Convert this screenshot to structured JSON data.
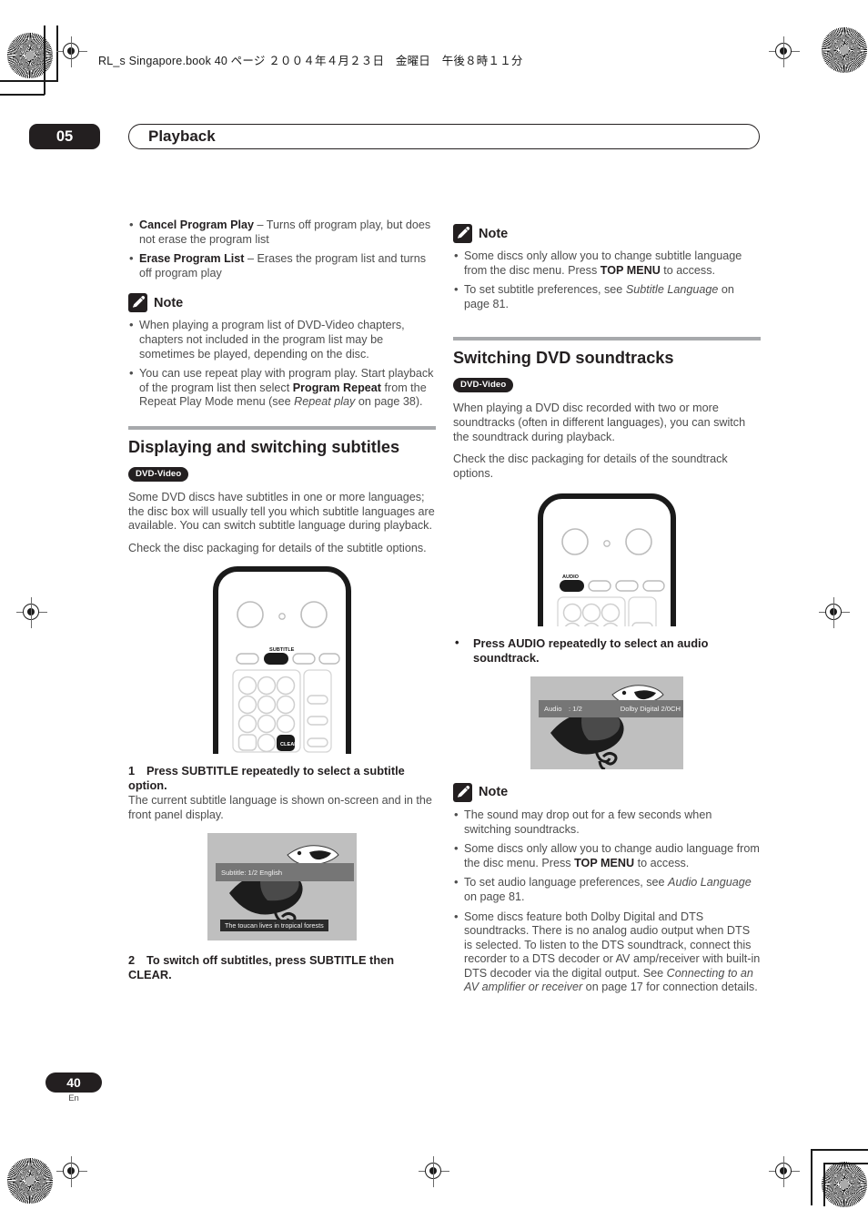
{
  "meta": {
    "running_head": "RL_s Singapore.book 40 ページ ２００４年４月２３日　金曜日　午後８時１１分",
    "chapter_number": "05",
    "chapter_title": "Playback",
    "page_number": "40",
    "page_language": "En",
    "accent_color": "#231f20",
    "rule_color": "#a7a9ac"
  },
  "left_column": {
    "program_bullets": [
      {
        "term": "Cancel Program Play",
        "rest": " – Turns off program play, but does not erase the program list"
      },
      {
        "term": "Erase Program List",
        "rest": " – Erases the program list and turns off program play"
      }
    ],
    "note1": {
      "label": "Note",
      "icon": "pencil-note-icon",
      "items": [
        {
          "parts": [
            {
              "text": "When playing a program list of DVD-Video chapters, chapters not included in the program list may be sometimes be played, depending on the disc.",
              "style": "normal"
            }
          ]
        },
        {
          "parts": [
            {
              "text": "You can use repeat play with program play. Start playback of the program list then select ",
              "style": "normal"
            },
            {
              "text": "Program Repeat",
              "style": "bold"
            },
            {
              "text": " from the Repeat Play Mode menu (see ",
              "style": "normal"
            },
            {
              "text": "Repeat play",
              "style": "italic"
            },
            {
              "text": " on page 38).",
              "style": "normal"
            }
          ]
        }
      ]
    },
    "section": {
      "title": "Displaying and switching subtitles",
      "badge": "DVD-Video",
      "paragraphs": [
        "Some DVD discs have subtitles in one or more languages; the disc box will usually tell you which subtitle languages are available. You can switch subtitle language during playback.",
        "Check the disc packaging for details of the subtitle options."
      ]
    },
    "remote": {
      "name": "remote-control-subtitle",
      "highlighted_buttons": [
        "SUBTITLE",
        "CLEAR"
      ],
      "subtitle_label": "SUBTITLE",
      "clear_label": "CLEAR"
    },
    "step1": {
      "number": "1",
      "heading": "Press SUBTITLE repeatedly to select a subtitle option.",
      "body": "The current subtitle language is shown on-screen and in the front panel display."
    },
    "osd": {
      "name": "on-screen-display-subtitle",
      "status_text": "Subtitle: 1/2 English",
      "caption_text": "The toucan lives in tropical forests"
    },
    "step2": {
      "number": "2",
      "heading": "To switch off subtitles, press SUBTITLE then CLEAR."
    }
  },
  "right_column": {
    "note1": {
      "label": "Note",
      "icon": "pencil-note-icon",
      "items": [
        {
          "parts": [
            {
              "text": "Some discs only allow you to change subtitle language from the disc menu. Press ",
              "style": "normal"
            },
            {
              "text": "TOP MENU",
              "style": "bold"
            },
            {
              "text": " to access.",
              "style": "normal"
            }
          ]
        },
        {
          "parts": [
            {
              "text": "To set subtitle preferences, see ",
              "style": "normal"
            },
            {
              "text": "Subtitle Language",
              "style": "italic"
            },
            {
              "text": " on page 81.",
              "style": "normal"
            }
          ]
        }
      ]
    },
    "section": {
      "title": "Switching DVD soundtracks",
      "badge": "DVD-Video",
      "paragraphs": [
        "When playing a DVD disc recorded with two or more soundtracks (often in different languages), you can switch the soundtrack during playback.",
        "Check the disc packaging for details of the soundtrack options."
      ]
    },
    "remote": {
      "name": "remote-control-audio",
      "highlighted_buttons": [
        "AUDIO"
      ],
      "audio_label": "AUDIO"
    },
    "step_bullet": {
      "heading": "Press AUDIO repeatedly to select an audio soundtrack."
    },
    "osd": {
      "name": "on-screen-display-audio",
      "status_left": "Audio　: 1/2",
      "status_right": "Dolby Digital 2/0CH"
    },
    "note2": {
      "label": "Note",
      "icon": "pencil-note-icon",
      "items": [
        {
          "parts": [
            {
              "text": "The sound may drop out for a few seconds when switching soundtracks.",
              "style": "normal"
            }
          ]
        },
        {
          "parts": [
            {
              "text": "Some discs only allow you to change audio language from the disc menu. Press ",
              "style": "normal"
            },
            {
              "text": "TOP MENU",
              "style": "bold"
            },
            {
              "text": " to access.",
              "style": "normal"
            }
          ]
        },
        {
          "parts": [
            {
              "text": "To set audio language preferences, see ",
              "style": "normal"
            },
            {
              "text": "Audio Language",
              "style": "italic"
            },
            {
              "text": " on page 81.",
              "style": "normal"
            }
          ]
        },
        {
          "parts": [
            {
              "text": "Some discs feature both Dolby Digital and DTS soundtracks. There is no analog audio output when DTS is selected. To listen to the DTS soundtrack, connect this recorder to a DTS decoder or AV amp/receiver with built-in DTS decoder via the digital output. See ",
              "style": "normal"
            },
            {
              "text": "Connecting to an AV amplifier or receiver",
              "style": "italic"
            },
            {
              "text": " on page 17 for connection details.",
              "style": "normal"
            }
          ]
        }
      ]
    }
  }
}
